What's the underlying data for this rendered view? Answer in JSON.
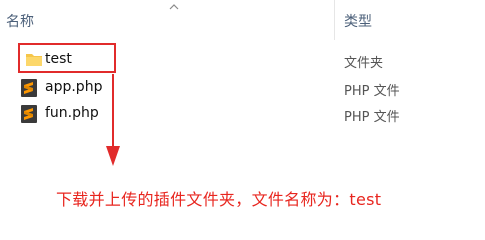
{
  "header": {
    "name_label": "名称",
    "type_label": "类型"
  },
  "files": [
    {
      "name": "test",
      "type": "文件夹",
      "icon": "folder-icon"
    },
    {
      "name": "app.php",
      "type": "PHP 文件",
      "icon": "sublime-file-icon"
    },
    {
      "name": "fun.php",
      "type": "PHP 文件",
      "icon": "sublime-file-icon"
    }
  ],
  "annotation": {
    "text": "下载并上传的插件文件夹，文件名称为：test"
  },
  "colors": {
    "highlight": "#e12b2b",
    "annotation": "#e8261f",
    "folder": "#f6c64a",
    "sublime_bg": "#3a3a3a",
    "sublime_s": "#ff9800"
  }
}
